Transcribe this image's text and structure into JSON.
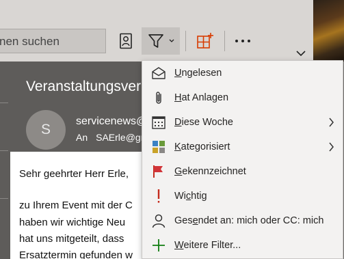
{
  "toolbar": {
    "search_placeholder": "nen suchen",
    "icons": [
      "contact-card-icon",
      "filter-icon",
      "add-column-icon",
      "more-icon",
      "chevron-down-icon"
    ],
    "colors": {
      "accent": "#d83b01",
      "background": "#d9d6d3"
    }
  },
  "message": {
    "title": "Veranstaltungsver",
    "avatar_initial": "S",
    "sender": "servicenews@",
    "to_label": "An",
    "to_address": "SAErle@gr",
    "body_lines": [
      "Sehr geehrter Herr Erle,",
      "zu Ihrem Event mit der C",
      "haben wir wichtige Neu",
      "hat uns mitgeteilt, dass",
      "Ersatztermin gefunden w"
    ]
  },
  "filter_menu": {
    "items": [
      {
        "accel": "U",
        "rest": "ngelesen",
        "icon": "envelope-open-icon"
      },
      {
        "accel": "H",
        "rest": "at Anlagen",
        "icon": "paperclip-icon"
      },
      {
        "accel": "D",
        "rest": "iese Woche",
        "icon": "calendar-icon",
        "submenu": true
      },
      {
        "accel": "K",
        "rest": "ategorisiert",
        "icon": "category-icon",
        "submenu": true
      },
      {
        "accel": "G",
        "rest": "ekennzeichnet",
        "icon": "flag-icon"
      },
      {
        "pre": "Wi",
        "accel": "c",
        "rest": "htig",
        "icon": "exclamation-icon"
      },
      {
        "pre": "Ges",
        "accel": "e",
        "rest": "ndet an: mich oder CC: mich",
        "icon": "person-icon"
      },
      {
        "accel": "W",
        "rest": "eitere Filter...",
        "icon": "plus-icon"
      }
    ]
  }
}
